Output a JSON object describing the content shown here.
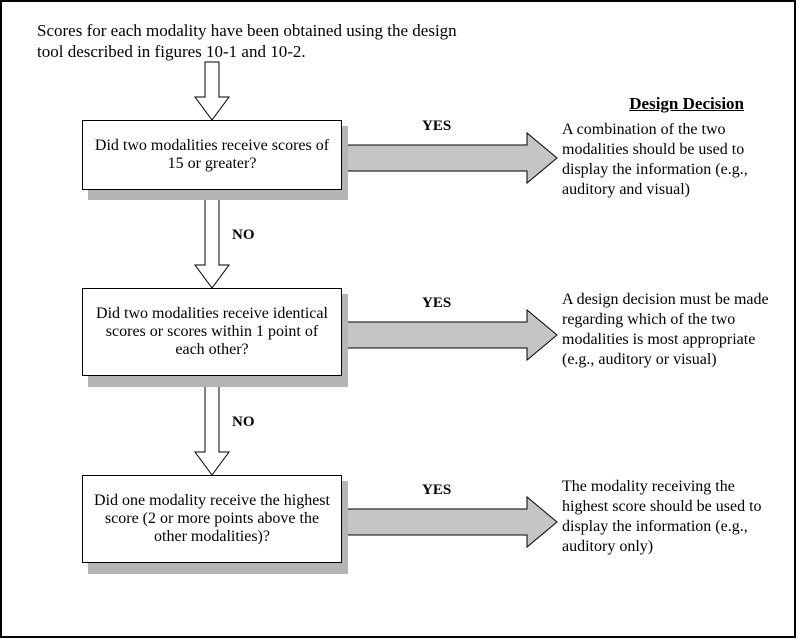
{
  "intro_text": "Scores for each modality have been obtained using the design tool described in figures 10-1 and 10-2.",
  "design_heading": "Design Decision",
  "decision1": {
    "question": "Did two modalities receive scores of 15 or greater?",
    "yes_label": "YES",
    "no_label": "NO",
    "result": "A combination of the two modalities should be used to display the information (e.g., auditory and visual)"
  },
  "decision2": {
    "question": "Did two modalities receive identical scores or scores within 1 point of each other?",
    "yes_label": "YES",
    "no_label": "NO",
    "result": "A design decision must be made regarding which of the two modalities is most appropriate (e.g., auditory or visual)"
  },
  "decision3": {
    "question": "Did one modality receive the highest score (2 or more points above the other modalities)?",
    "yes_label": "YES",
    "result": "The modality receiving the highest score should be used to display the information (e.g., auditory only)"
  }
}
